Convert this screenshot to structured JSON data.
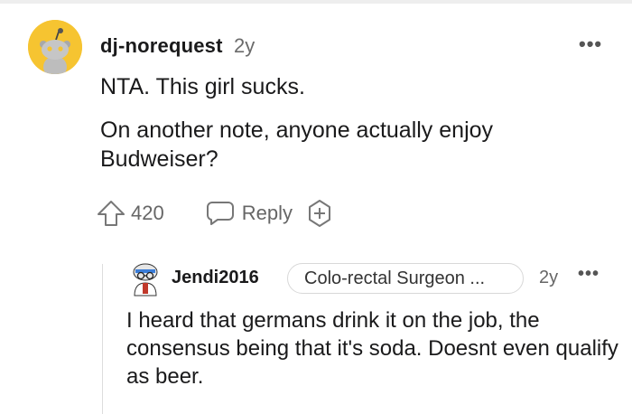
{
  "comment": {
    "username": "dj-norequest",
    "age": "2y",
    "more_label": "•••",
    "body_line1": "NTA. This girl sucks.",
    "body_line2": "On another note, anyone actually enjoy Budweiser?",
    "upvotes": "420",
    "reply_label": "Reply",
    "avatar_icon": "snoo-avatar-icon",
    "avatar_color": "#f6c431"
  },
  "reply": {
    "username": "Jendi2016",
    "flair": "Colo-rectal Surgeon ...",
    "age": "2y",
    "more_label": "•••",
    "body": "I heard that germans drink it on the job, the consensus being that it's soda. Doesnt even qualify as beer."
  }
}
